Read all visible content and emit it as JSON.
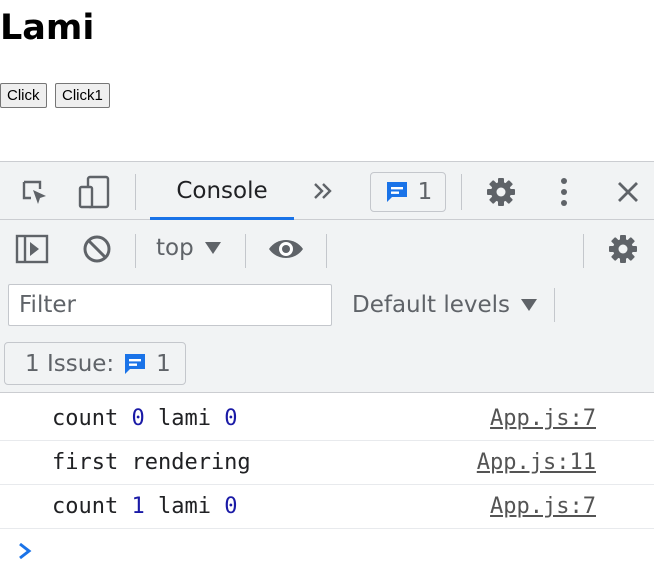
{
  "page": {
    "title": "Lami",
    "buttons": [
      "Click",
      "Click1"
    ]
  },
  "devtools": {
    "tabs": {
      "console_label": "Console",
      "badge_count": "1"
    },
    "toolbar": {
      "context": "top"
    },
    "filter": {
      "placeholder": "Filter",
      "levels_label": "Default levels"
    },
    "issues": {
      "label": "1 Issue:",
      "count": "1"
    },
    "logs": [
      {
        "parts": [
          "count ",
          "0",
          " lami ",
          "0"
        ],
        "source": "App.js:7"
      },
      {
        "parts": [
          "first rendering"
        ],
        "source": "App.js:11"
      },
      {
        "parts": [
          "count ",
          "1",
          " lami ",
          "0"
        ],
        "source": "App.js:7"
      }
    ],
    "colors": {
      "accent": "#1a73e8",
      "number": "#1a1aa6",
      "icon": "#5f6368"
    }
  }
}
